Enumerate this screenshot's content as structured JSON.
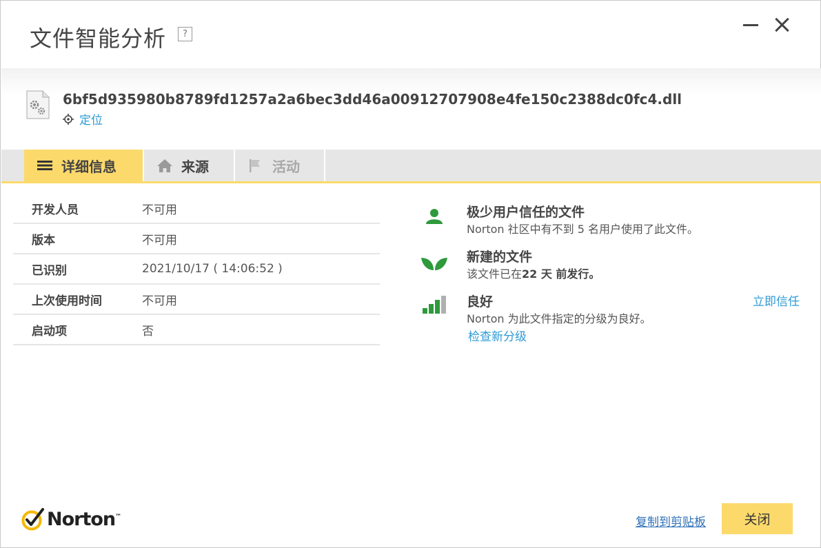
{
  "window": {
    "title": "文件智能分析",
    "help": "?"
  },
  "file": {
    "name": "6bf5d935980b8789fd1257a2a6bec3dd46a00912707908e4fe150c2388dc0fc4.dll",
    "locate_label": "定位"
  },
  "tabs": [
    {
      "label": "详细信息",
      "icon": "list-icon",
      "state": "active"
    },
    {
      "label": "来源",
      "icon": "home-icon",
      "state": "normal"
    },
    {
      "label": "活动",
      "icon": "flag-icon",
      "state": "disabled"
    }
  ],
  "details": [
    {
      "key": "开发人员",
      "value": "不可用"
    },
    {
      "key": "版本",
      "value": "不可用"
    },
    {
      "key": "已识别",
      "value": "2021/10/17 ( 14:06:52 )"
    },
    {
      "key": "上次使用时间",
      "value": "不可用"
    },
    {
      "key": "启动项",
      "value": "否"
    }
  ],
  "insights": {
    "trust": {
      "icon": "user-icon",
      "title": "极少用户信任的文件",
      "desc": "Norton 社区中有不到 5 名用户使用了此文件。"
    },
    "age": {
      "icon": "leaf-icon",
      "title": "新建的文件",
      "desc_prefix": "该文件已在",
      "desc_bold": "22 天 前发行。"
    },
    "rating": {
      "icon": "signal-bars-icon",
      "title": "良好",
      "desc": "Norton 为此文件指定的分级为良好。",
      "check_link": "检查新分级",
      "trust_now_link": "立即信任",
      "bars_filled": 3,
      "bars_total": 4
    }
  },
  "footer": {
    "brand": "Norton",
    "trademark": "™",
    "copy_link": "复制到剪贴板",
    "close_button": "关闭"
  },
  "colors": {
    "accent_yellow": "#fcd96b",
    "link_blue": "#2e9bd6",
    "green": "#2e9a3c",
    "tab_bg": "#e6e6e6"
  }
}
